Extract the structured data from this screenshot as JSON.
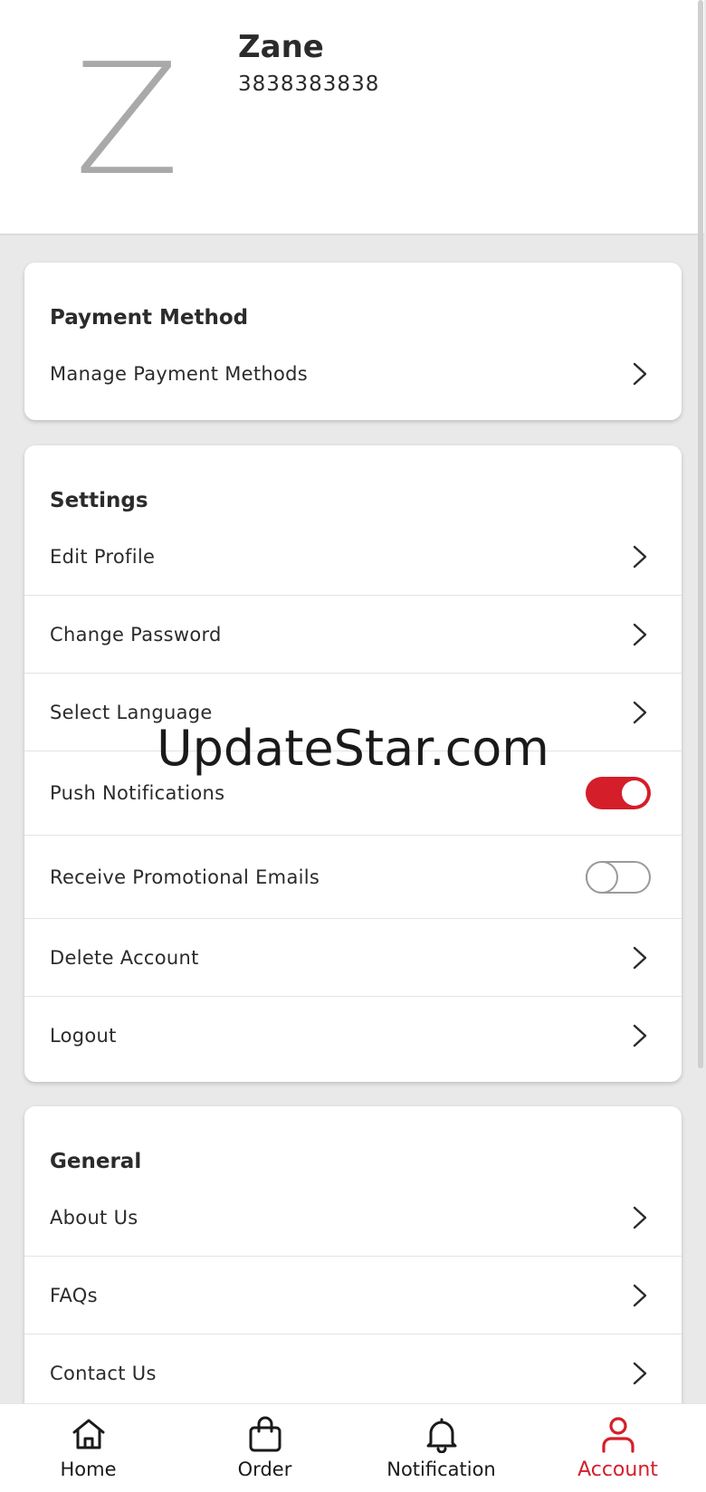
{
  "profile": {
    "avatar_letter": "Z",
    "name": "Zane",
    "phone": "3838383838"
  },
  "payment": {
    "title": "Payment Method",
    "items": [
      {
        "label": "Manage Payment Methods"
      }
    ]
  },
  "settings": {
    "title": "Settings",
    "items": [
      {
        "label": "Edit Profile"
      },
      {
        "label": "Change Password"
      },
      {
        "label": "Select Language"
      },
      {
        "label": "Push Notifications",
        "toggle": true,
        "enabled": true
      },
      {
        "label": "Receive Promotional Emails",
        "toggle": true,
        "enabled": false
      },
      {
        "label": "Delete Account"
      },
      {
        "label": "Logout"
      }
    ]
  },
  "general": {
    "title": "General",
    "items": [
      {
        "label": "About Us"
      },
      {
        "label": "FAQs"
      },
      {
        "label": "Contact Us"
      }
    ]
  },
  "watermark": "UpdateStar.com",
  "bottom_nav": {
    "items": [
      {
        "label": "Home",
        "icon": "home-icon",
        "active": false
      },
      {
        "label": "Order",
        "icon": "shopping-bag-icon",
        "active": false
      },
      {
        "label": "Notification",
        "icon": "bell-icon",
        "active": false
      },
      {
        "label": "Account",
        "icon": "user-icon",
        "active": true
      }
    ]
  },
  "colors": {
    "accent": "#d41e2a",
    "background": "#e9e9e9",
    "card": "#ffffff",
    "avatar_letter": "#a9a9a9"
  }
}
